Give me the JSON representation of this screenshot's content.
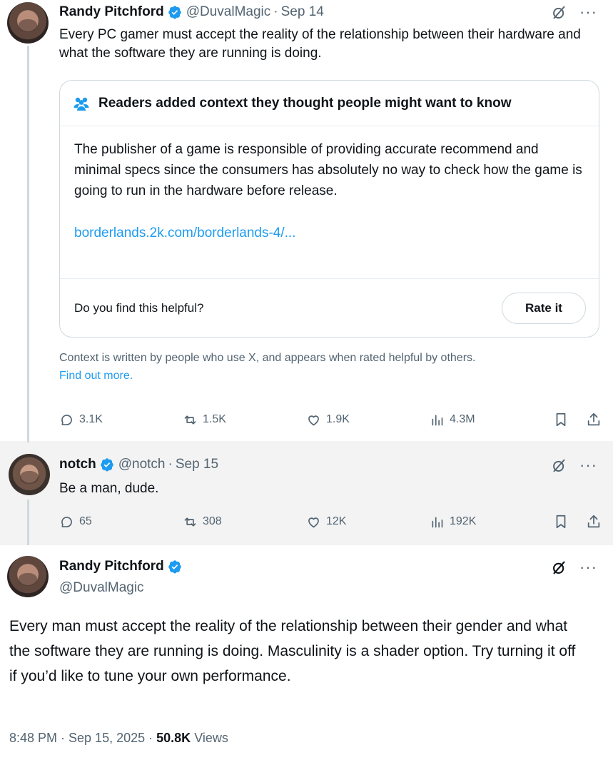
{
  "post1": {
    "name": "Randy Pitchford",
    "handle": "@DuvalMagic",
    "separator": "·",
    "date": "Sep 14",
    "more": "···",
    "text": "Every PC gamer must accept the reality of the relationship between their hardware and what the software they are running is doing.",
    "community_note": {
      "title": "Readers added context they thought people might want to know",
      "body": "The publisher of a game is responsible of providing accurate recommend and minimal specs since the consumers has absolutely no way to check how the game is going to run in the hardware before release.",
      "link": "borderlands.2k.com/borderlands-4/...",
      "helpful_prompt": "Do you find this helpful?",
      "rate_button": "Rate it"
    },
    "disclaimer": "Context is written by people who use X, and appears when rated helpful by others.",
    "find_out_more": "Find out more.",
    "metrics": {
      "replies": "3.1K",
      "reposts": "1.5K",
      "likes": "1.9K",
      "views": "4.3M"
    }
  },
  "post2": {
    "name": "notch",
    "handle": "@notch",
    "separator": "·",
    "date": "Sep 15",
    "more": "···",
    "text": "Be a man, dude.",
    "metrics": {
      "replies": "65",
      "reposts": "308",
      "likes": "12K",
      "views": "192K"
    }
  },
  "post3": {
    "name": "Randy Pitchford",
    "handle": "@DuvalMagic",
    "more": "···",
    "text": "Every man must accept the reality of the relationship between their gender and what the software they are running is doing. Masculinity is a shader option. Try turning it off if you’d like to tune your own performance.",
    "timestamp": "8:48 PM · Sep 15, 2025 ·",
    "views_count": "50.8K",
    "views_label": "Views"
  },
  "colors": {
    "accent": "#1d9bf0",
    "muted": "#536471",
    "reply_bg": "#f3f3f3"
  }
}
